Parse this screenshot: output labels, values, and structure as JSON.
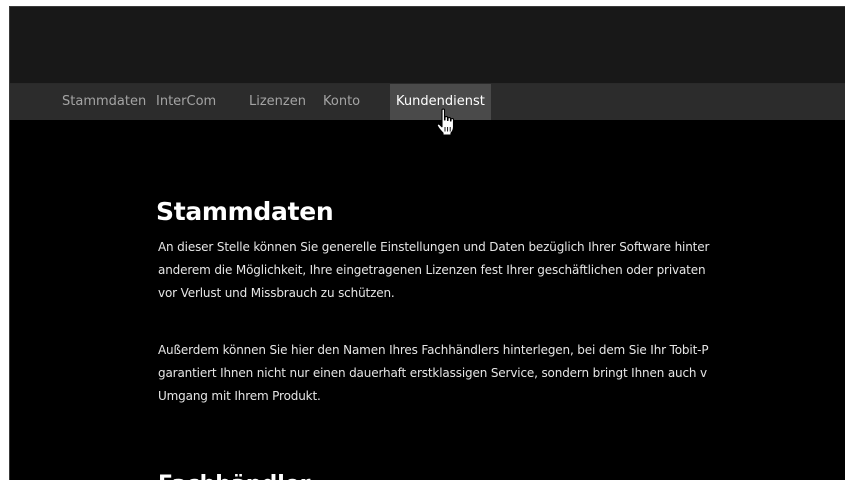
{
  "nav": {
    "items": [
      {
        "label": "Stammdaten"
      },
      {
        "label": "InterCom"
      },
      {
        "label": "Lizenzen"
      },
      {
        "label": "Konto"
      },
      {
        "label": "Kundendienst"
      }
    ]
  },
  "main": {
    "heading": "Stammdaten",
    "paragraph1": [
      "An dieser Stelle können Sie generelle Einstellungen und Daten bezüglich Ihrer Software hinter",
      "anderem die Möglichkeit, Ihre eingetragenen Lizenzen fest Ihrer geschäftlichen oder privaten",
      "vor Verlust und Missbrauch zu schützen."
    ],
    "paragraph2": [
      "Außerdem können Sie hier den Namen Ihres Fachhändlers hinterlegen, bei dem Sie Ihr Tobit-P",
      "garantiert Ihnen nicht nur einen dauerhaft erstklassigen Service, sondern bringt Ihnen auch v",
      "Umgang mit Ihrem Produkt."
    ]
  },
  "colors": {
    "background": "#000000",
    "navbar": "#2c2c2c",
    "nav_active": "#4a4a4a",
    "nav_text": "#a4a4a4",
    "text": "#ffffff"
  },
  "cursor_icon": "hand-pointer-icon"
}
